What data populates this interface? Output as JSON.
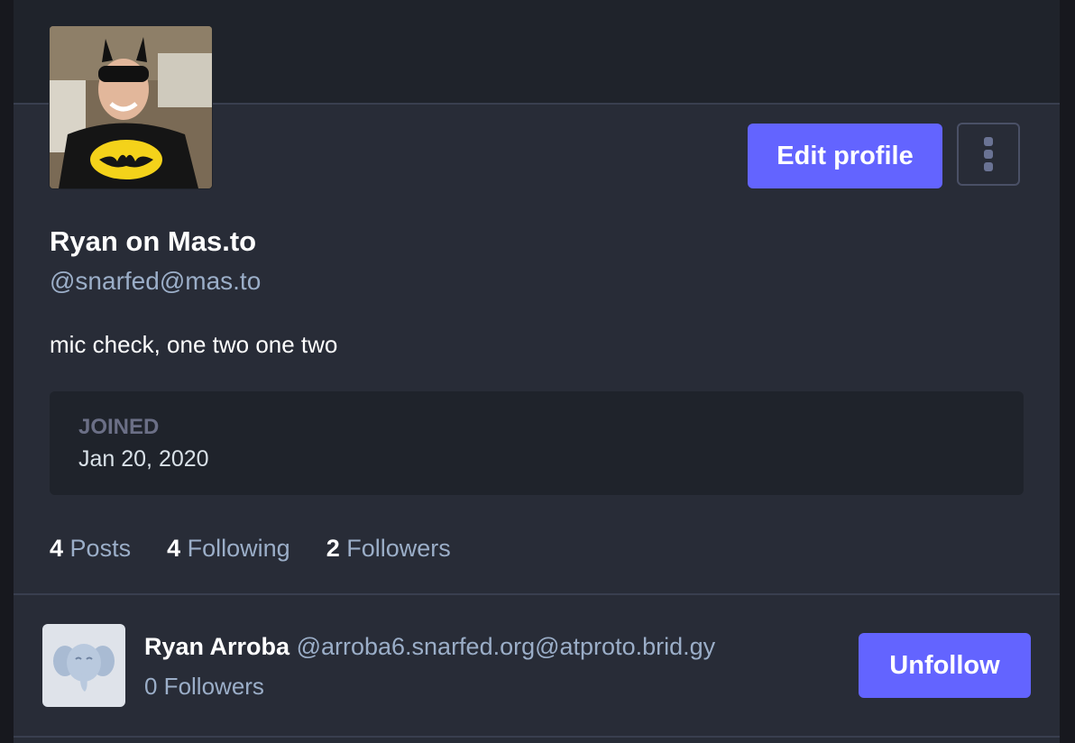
{
  "profile": {
    "avatar_icon": "profile-photo-batman-costume",
    "edit_button_label": "Edit profile",
    "menu_icon": "vertical-ellipsis-icon",
    "display_name": "Ryan on Mas.to",
    "handle": "@snarfed@mas.to",
    "bio": "mic check, one two one two",
    "joined_label": "JOINED",
    "joined_date": "Jan 20, 2020",
    "stats": [
      {
        "count": "4",
        "label": "Posts"
      },
      {
        "count": "4",
        "label": "Following"
      },
      {
        "count": "2",
        "label": "Followers"
      }
    ]
  },
  "following_list": [
    {
      "avatar_icon": "default-mastodon-elephant-avatar",
      "name": "Ryan Arroba",
      "handle": "@arroba6.snarfed.org@atproto.brid.gy",
      "followers": "0 Followers",
      "action_label": "Unfollow"
    }
  ],
  "colors": {
    "accent": "#6364ff",
    "background": "#282c37",
    "panel": "#1f232b",
    "muted_text": "#9baec8"
  }
}
